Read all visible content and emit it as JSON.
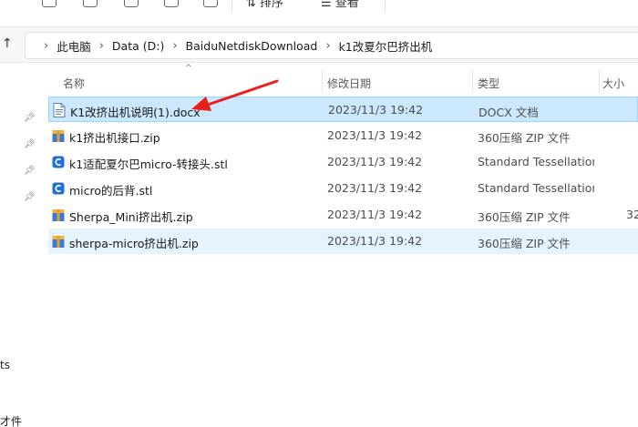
{
  "toolbar": {
    "sort_label": "排序",
    "view_label": "查看",
    "more_label": "···"
  },
  "breadcrumb": [
    "此电脑",
    "Data (D:)",
    "BaiduNetdiskDownload",
    "k1改夏尔巴挤出机"
  ],
  "columns": {
    "name": "名称",
    "modified": "修改日期",
    "type": "类型",
    "size": "大小"
  },
  "files": [
    {
      "name": "K1改挤出机说明(1).docx",
      "modified": "2023/11/3 19:42",
      "type": "DOCX 文档",
      "size": "",
      "icon": "docx-file-icon"
    },
    {
      "name": "k1挤出机接口.zip",
      "modified": "2023/11/3 19:42",
      "type": "360压缩 ZIP 文件",
      "size": "",
      "icon": "zip-archive-icon"
    },
    {
      "name": "k1适配夏尔巴micro-转接头.stl",
      "modified": "2023/11/3 19:42",
      "type": "Standard Tessellation...",
      "size": "",
      "icon": "stl-file-icon"
    },
    {
      "name": "micro的后背.stl",
      "modified": "2023/11/3 19:42",
      "type": "Standard Tessellation...",
      "size": "",
      "icon": "stl-file-icon"
    },
    {
      "name": "Sherpa_Mini挤出机.zip",
      "modified": "2023/11/3 19:42",
      "type": "360压缩 ZIP 文件",
      "size": "32",
      "icon": "zip-archive-icon"
    },
    {
      "name": "sherpa-micro挤出机.zip",
      "modified": "2023/11/3 19:42",
      "type": "360压缩 ZIP 文件",
      "size": "",
      "icon": "zip-archive-icon"
    }
  ],
  "nav_fragments": [
    "ts",
    "才件"
  ],
  "colors": {
    "selection_bg": "#cce8ff",
    "selection_border": "#99d1ff",
    "hover_bg": "#e5f3ff",
    "annotation_arrow": "#e8201c",
    "zip_icon": "#3b78d8",
    "stl_icon": "#1e6fd9"
  }
}
